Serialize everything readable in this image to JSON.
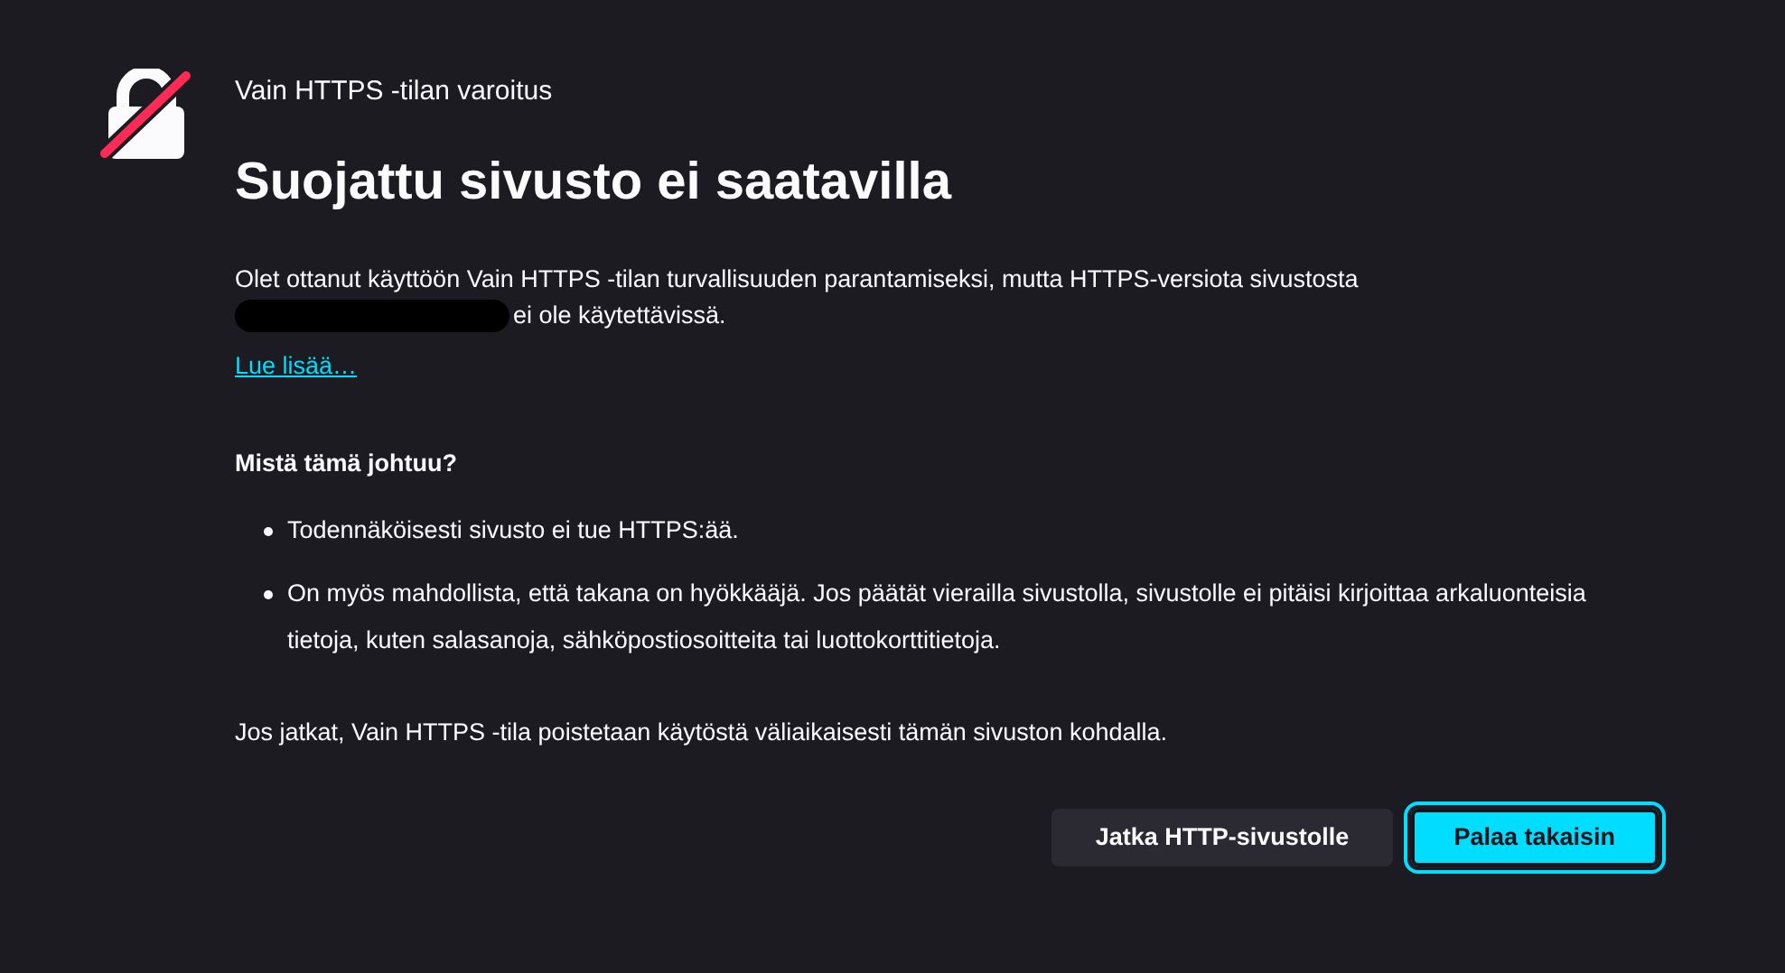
{
  "page": {
    "eyebrow": "Vain HTTPS -tilan varoitus",
    "title": "Suojattu sivusto ei saatavilla"
  },
  "intro": {
    "text": "Olet ottanut käyttöön Vain HTTPS -tilan turvallisuuden parantamiseksi, mutta HTTPS-versiota sivustosta",
    "site_redacted": true,
    "text_end": "ei ole käytettävissä."
  },
  "learn_more_link": "Lue lisää…",
  "reasons": {
    "heading": "Mistä tämä johtuu?",
    "items": [
      "Todennäköisesti sivusto ei tue HTTPS:ää.",
      "On myös mahdollista, että takana on hyökkääjä. Jos päätät vierailla sivustolla, sivustolle ei pitäisi kirjoittaa arkaluonteisia tietoja, kuten salasanoja, sähköpostiosoitteita tai luottokorttitietoja."
    ]
  },
  "footer_note": "Jos jatkat, Vain HTTPS -tila poistetaan käytöstä väliaikaisesti tämän sivuston kohdalla.",
  "buttons": [
    {
      "label": "Jatka HTTP-sivustolle",
      "kind": "secondary",
      "focused": false
    },
    {
      "label": "Palaa takaisin",
      "kind": "primary",
      "focused": true
    }
  ]
}
